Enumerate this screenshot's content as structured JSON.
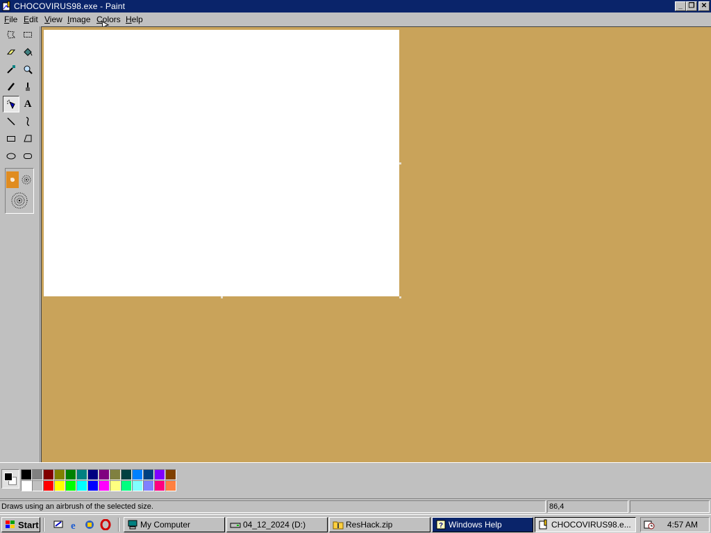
{
  "window": {
    "title": "CHOCOVIRUS98.exe - Paint",
    "minimize_glyph": "_",
    "restore_glyph": "❐",
    "close_glyph": "✕"
  },
  "menu": [
    {
      "first": "F",
      "rest": "ile"
    },
    {
      "first": "E",
      "rest": "dit"
    },
    {
      "first": "V",
      "rest": "iew"
    },
    {
      "first": "I",
      "rest": "mage"
    },
    {
      "first": "C",
      "rest": "olors"
    },
    {
      "first": "H",
      "rest": "elp"
    }
  ],
  "tools": [
    {
      "name": "free-form-select-icon",
      "selected": false
    },
    {
      "name": "rect-select-icon",
      "selected": false
    },
    {
      "name": "eraser-icon",
      "selected": false
    },
    {
      "name": "fill-bucket-icon",
      "selected": false
    },
    {
      "name": "color-picker-icon",
      "selected": false
    },
    {
      "name": "magnifier-icon",
      "selected": false
    },
    {
      "name": "pencil-icon",
      "selected": false
    },
    {
      "name": "brush-icon",
      "selected": false
    },
    {
      "name": "airbrush-icon",
      "selected": true
    },
    {
      "name": "text-icon",
      "selected": false,
      "glyph": "A"
    },
    {
      "name": "line-icon",
      "selected": false
    },
    {
      "name": "curve-icon",
      "selected": false
    },
    {
      "name": "rectangle-icon",
      "selected": false
    },
    {
      "name": "polygon-icon",
      "selected": false
    },
    {
      "name": "ellipse-icon",
      "selected": false
    },
    {
      "name": "rounded-rect-icon",
      "selected": false
    }
  ],
  "colors": {
    "foreground": "#000000",
    "background": "#ffffff",
    "workspace": "#c9a35a",
    "titlebar": "#0a246a",
    "palette_top": [
      "#000000",
      "#808080",
      "#800000",
      "#808000",
      "#008000",
      "#008080",
      "#000080",
      "#800080",
      "#808040",
      "#004040",
      "#0080ff",
      "#004080",
      "#8000ff",
      "#804000"
    ],
    "palette_bottom": [
      "#ffffff",
      "#c0c0c0",
      "#ff0000",
      "#ffff00",
      "#00ff00",
      "#00ffff",
      "#0000ff",
      "#ff00ff",
      "#ffff80",
      "#00ff80",
      "#80ffff",
      "#8080ff",
      "#ff0080",
      "#ff8040"
    ]
  },
  "status": {
    "message": "Draws using an airbrush of the selected size.",
    "coords": "86,4",
    "size": ""
  },
  "taskbar": {
    "start_label": "Start",
    "quick_launch": [
      "desktop-icon",
      "ie-icon",
      "channels-icon",
      "opera-icon"
    ],
    "tasks": [
      {
        "label": "My Computer",
        "icon": "computer-icon",
        "state": "normal"
      },
      {
        "label": "04_12_2024 (D:)",
        "icon": "drive-icon",
        "state": "normal"
      },
      {
        "label": "ResHack.zip",
        "icon": "zip-folder-icon",
        "state": "normal"
      },
      {
        "label": "Windows Help",
        "icon": "help-icon",
        "state": "flash"
      },
      {
        "label": "CHOCOVIRUS98.e...",
        "icon": "paint-icon",
        "state": "active"
      }
    ],
    "clock": "4:57 AM"
  }
}
